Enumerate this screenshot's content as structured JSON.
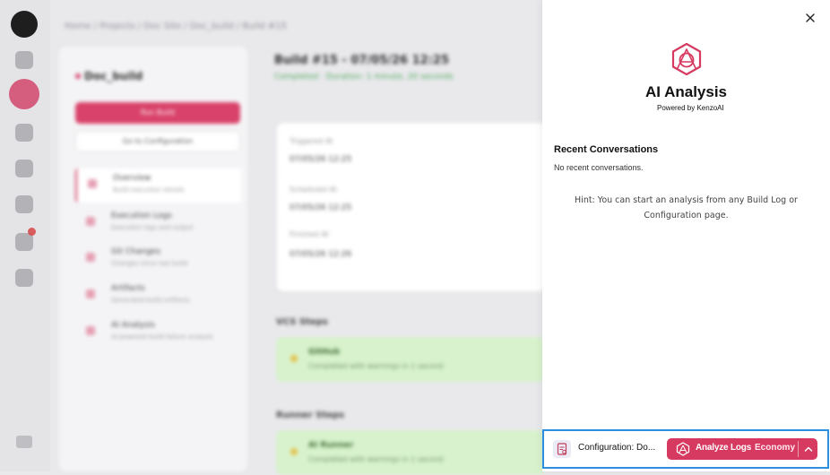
{
  "background": {
    "breadcrumb": "Home / Projects / Doc Site / Doc_build / Build #15",
    "project": {
      "name": "Doc_build",
      "run_button": "Run Build",
      "config_button": "Go to Configuration",
      "nav": [
        {
          "label": "Overview",
          "sub": "Build execution details"
        },
        {
          "label": "Execution Logs",
          "sub": "Execution logs and output"
        },
        {
          "label": "Git Changes",
          "sub": "Changes since last build"
        },
        {
          "label": "Artifacts",
          "sub": "Generated build artifacts"
        },
        {
          "label": "AI Analysis",
          "sub": "AI-powered build failure analysis"
        }
      ]
    },
    "build": {
      "title": "Build #15 - 07/05/26 12:25",
      "status": "Completed · Duration: 1 minute, 20 seconds",
      "triggered_label": "Triggered At",
      "triggered_value": "07/05/26 12:25",
      "scheduled_label": "Scheduled At",
      "scheduled_value": "07/05/26 12:25",
      "finished_label": "Finished At",
      "finished_value": "07/05/26 12:26",
      "vcs_title": "VCS Steps",
      "vcs_step": {
        "name": "GitHub",
        "detail": "Completed with warnings in 1 second"
      },
      "runner_title": "Runner Steps",
      "runner_step": {
        "name": "AI Runner",
        "detail": "Completed with warnings in 1 second"
      }
    }
  },
  "panel": {
    "title": "AI Analysis",
    "powered_by": "Powered by KenzoAI",
    "recent_title": "Recent Conversations",
    "recent_empty": "No recent conversations.",
    "hint": "Hint: You can start an analysis from any Build Log or Configuration page."
  },
  "bottom_bar": {
    "context_label": "Configuration: Do...",
    "analyze_label": "Analyze Logs",
    "mode_label": "Economy"
  },
  "colors": {
    "accent": "#d63a60",
    "highlight_border": "#2d8fe0"
  }
}
